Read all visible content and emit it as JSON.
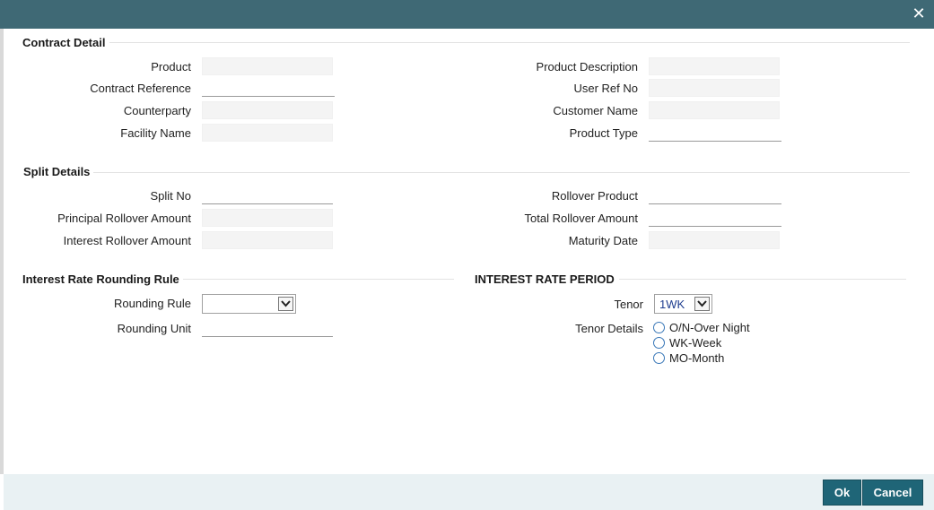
{
  "window": {
    "close_label": "✕"
  },
  "contract_detail": {
    "title": "Contract Detail",
    "left": [
      {
        "label": "Product",
        "value": ""
      },
      {
        "label": "Contract Reference",
        "value": ""
      },
      {
        "label": "Counterparty",
        "value": ""
      },
      {
        "label": "Facility Name",
        "value": ""
      }
    ],
    "right": [
      {
        "label": "Product Description",
        "value": ""
      },
      {
        "label": "User Ref No",
        "value": ""
      },
      {
        "label": "Customer Name",
        "value": ""
      },
      {
        "label": "Product Type",
        "value": ""
      }
    ]
  },
  "split_details": {
    "title": "Split Details",
    "left": [
      {
        "label": "Split No",
        "value": ""
      },
      {
        "label": "Principal Rollover Amount",
        "value": ""
      },
      {
        "label": "Interest Rollover Amount",
        "value": ""
      }
    ],
    "right": [
      {
        "label": "Rollover Product",
        "value": ""
      },
      {
        "label": "Total Rollover Amount",
        "value": ""
      },
      {
        "label": "Maturity Date",
        "value": ""
      }
    ]
  },
  "rounding": {
    "title": "Interest Rate Rounding Rule",
    "rule_label": "Rounding Rule",
    "rule_value": "",
    "unit_label": "Rounding Unit",
    "unit_value": ""
  },
  "period": {
    "title": "INTEREST RATE PERIOD",
    "tenor_label": "Tenor",
    "tenor_value": "1WK",
    "details_label": "Tenor Details",
    "options": [
      "O/N-Over Night",
      "WK-Week",
      "MO-Month"
    ]
  },
  "footer": {
    "ok_label": "Ok",
    "cancel_label": "Cancel"
  },
  "colors": {
    "titlebar": "#3f6975",
    "button": "#1f6577",
    "footer": "#e9f1f3"
  }
}
